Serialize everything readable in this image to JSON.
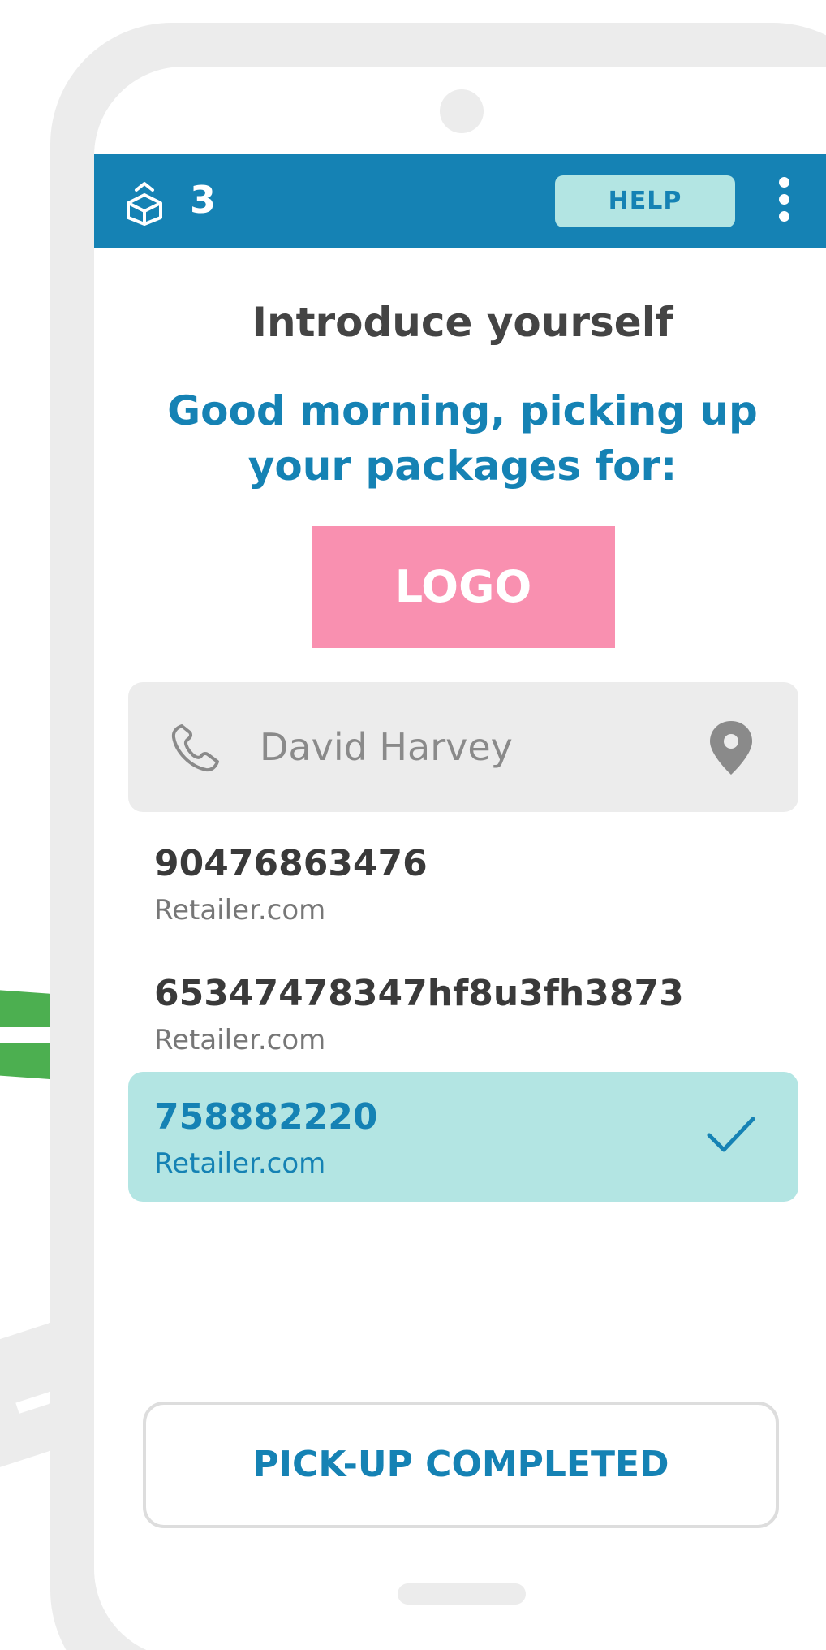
{
  "app_bar": {
    "count": "3",
    "help_label": "HELP"
  },
  "content": {
    "title": "Introduce yourself",
    "greeting_line1": "Good morning, picking up",
    "greeting_line2": "your packages for:",
    "logo_text": "LOGO"
  },
  "contact": {
    "name": "David Harvey"
  },
  "packages": [
    {
      "id": "90476863476",
      "retailer": "Retailer.com",
      "selected": false
    },
    {
      "id": "65347478347hf8u3fh3873",
      "retailer": "Retailer.com",
      "selected": false
    },
    {
      "id": "758882220",
      "retailer": "Retailer.com",
      "selected": true
    }
  ],
  "footer": {
    "complete_label": "PICK-UP COMPLETED"
  },
  "colors": {
    "primary": "#1582b4",
    "accent_light": "#b3e5e3",
    "logo_pink": "#f990b0",
    "frame_grey": "#ececec",
    "decor_green": "#4caf50"
  },
  "icons": {
    "app": "box-icon",
    "menu": "kebab-menu-icon",
    "call": "phone-icon",
    "location": "map-pin-icon",
    "selected": "check-icon"
  }
}
